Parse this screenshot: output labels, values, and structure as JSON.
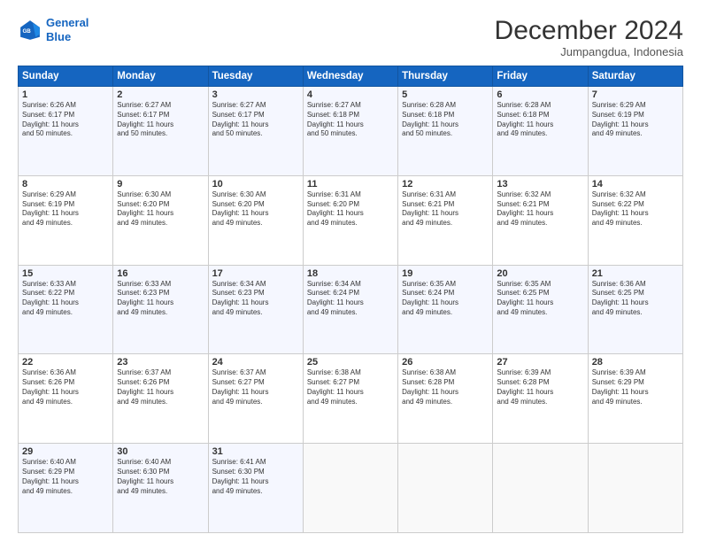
{
  "header": {
    "logo_line1": "General",
    "logo_line2": "Blue",
    "main_title": "December 2024",
    "subtitle": "Jumpangdua, Indonesia"
  },
  "calendar": {
    "days_of_week": [
      "Sunday",
      "Monday",
      "Tuesday",
      "Wednesday",
      "Thursday",
      "Friday",
      "Saturday"
    ],
    "weeks": [
      [
        null,
        {
          "day": 2,
          "sr": "6:27 AM",
          "ss": "6:17 PM",
          "dl": "11 hours and 50 minutes."
        },
        {
          "day": 3,
          "sr": "6:27 AM",
          "ss": "6:17 PM",
          "dl": "11 hours and 50 minutes."
        },
        {
          "day": 4,
          "sr": "6:27 AM",
          "ss": "6:18 PM",
          "dl": "11 hours and 50 minutes."
        },
        {
          "day": 5,
          "sr": "6:28 AM",
          "ss": "6:18 PM",
          "dl": "11 hours and 50 minutes."
        },
        {
          "day": 6,
          "sr": "6:28 AM",
          "ss": "6:18 PM",
          "dl": "11 hours and 49 minutes."
        },
        {
          "day": 7,
          "sr": "6:29 AM",
          "ss": "6:19 PM",
          "dl": "11 hours and 49 minutes."
        }
      ],
      [
        {
          "day": 8,
          "sr": "6:29 AM",
          "ss": "6:19 PM",
          "dl": "11 hours and 49 minutes."
        },
        {
          "day": 9,
          "sr": "6:30 AM",
          "ss": "6:20 PM",
          "dl": "11 hours and 49 minutes."
        },
        {
          "day": 10,
          "sr": "6:30 AM",
          "ss": "6:20 PM",
          "dl": "11 hours and 49 minutes."
        },
        {
          "day": 11,
          "sr": "6:31 AM",
          "ss": "6:20 PM",
          "dl": "11 hours and 49 minutes."
        },
        {
          "day": 12,
          "sr": "6:31 AM",
          "ss": "6:21 PM",
          "dl": "11 hours and 49 minutes."
        },
        {
          "day": 13,
          "sr": "6:32 AM",
          "ss": "6:21 PM",
          "dl": "11 hours and 49 minutes."
        },
        {
          "day": 14,
          "sr": "6:32 AM",
          "ss": "6:22 PM",
          "dl": "11 hours and 49 minutes."
        }
      ],
      [
        {
          "day": 15,
          "sr": "6:33 AM",
          "ss": "6:22 PM",
          "dl": "11 hours and 49 minutes."
        },
        {
          "day": 16,
          "sr": "6:33 AM",
          "ss": "6:23 PM",
          "dl": "11 hours and 49 minutes."
        },
        {
          "day": 17,
          "sr": "6:34 AM",
          "ss": "6:23 PM",
          "dl": "11 hours and 49 minutes."
        },
        {
          "day": 18,
          "sr": "6:34 AM",
          "ss": "6:24 PM",
          "dl": "11 hours and 49 minutes."
        },
        {
          "day": 19,
          "sr": "6:35 AM",
          "ss": "6:24 PM",
          "dl": "11 hours and 49 minutes."
        },
        {
          "day": 20,
          "sr": "6:35 AM",
          "ss": "6:25 PM",
          "dl": "11 hours and 49 minutes."
        },
        {
          "day": 21,
          "sr": "6:36 AM",
          "ss": "6:25 PM",
          "dl": "11 hours and 49 minutes."
        }
      ],
      [
        {
          "day": 22,
          "sr": "6:36 AM",
          "ss": "6:26 PM",
          "dl": "11 hours and 49 minutes."
        },
        {
          "day": 23,
          "sr": "6:37 AM",
          "ss": "6:26 PM",
          "dl": "11 hours and 49 minutes."
        },
        {
          "day": 24,
          "sr": "6:37 AM",
          "ss": "6:27 PM",
          "dl": "11 hours and 49 minutes."
        },
        {
          "day": 25,
          "sr": "6:38 AM",
          "ss": "6:27 PM",
          "dl": "11 hours and 49 minutes."
        },
        {
          "day": 26,
          "sr": "6:38 AM",
          "ss": "6:28 PM",
          "dl": "11 hours and 49 minutes."
        },
        {
          "day": 27,
          "sr": "6:39 AM",
          "ss": "6:28 PM",
          "dl": "11 hours and 49 minutes."
        },
        {
          "day": 28,
          "sr": "6:39 AM",
          "ss": "6:29 PM",
          "dl": "11 hours and 49 minutes."
        }
      ],
      [
        {
          "day": 29,
          "sr": "6:40 AM",
          "ss": "6:29 PM",
          "dl": "11 hours and 49 minutes."
        },
        {
          "day": 30,
          "sr": "6:40 AM",
          "ss": "6:30 PM",
          "dl": "11 hours and 49 minutes."
        },
        {
          "day": 31,
          "sr": "6:41 AM",
          "ss": "6:30 PM",
          "dl": "11 hours and 49 minutes."
        },
        null,
        null,
        null,
        null
      ]
    ]
  }
}
